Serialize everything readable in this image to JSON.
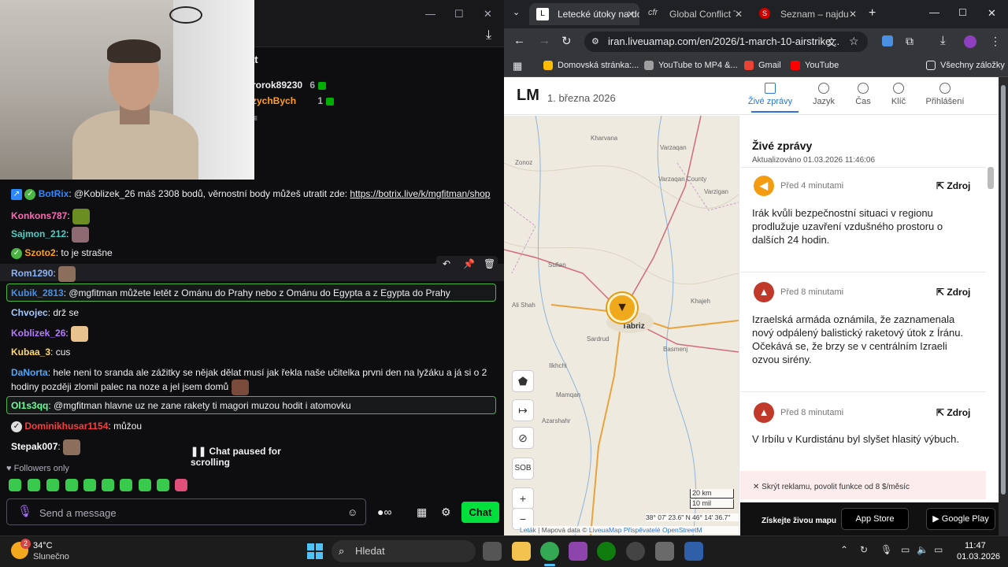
{
  "chat": {
    "title": "at",
    "leaders": [
      {
        "name": "rorok89230",
        "count": "6"
      },
      {
        "name": "zychBych",
        "count": "1"
      }
    ],
    "messages": [
      {
        "user": "BotRix",
        "text": ": @Koblizek_26 máš 2308 bodů, věrnostní body můžeš utratit zde: ",
        "link": "https://botrix.live/k/mgfitman/shop",
        "color": "#2d88ff"
      },
      {
        "user": "Konkons787",
        "text": ":",
        "color": "#ff69b4"
      },
      {
        "user": "Sajmon_212",
        "text": ":",
        "color": "#4ecdc4"
      },
      {
        "user": "Szoto2",
        "text": ": to je strašne",
        "color": "#ff9f1a"
      },
      {
        "user": "Rom1290",
        "text": ":",
        "color": "#8ab4f8"
      },
      {
        "user": "Kubik_2813",
        "text": ": @mgfitman můžete letět z Ománu do Prahy nebo z Ománu do Egypta a z Egypta do Prahy",
        "color": "#4a90e2"
      },
      {
        "user": "Chvojec",
        "text": ": drž se",
        "color": "#a3c9ff"
      },
      {
        "user": "Koblizek_26",
        "text": ":",
        "color": "#b57bff"
      },
      {
        "user": "Kubaa_3",
        "text": ": cus",
        "color": "#ffd966"
      },
      {
        "user": "DaNorta",
        "text": ": hele neni to sranda ale zážitky se nějak dělat musí jak řekla naše učitelka prvni den na lyžáku a já si o 2",
        "text2": "hodiny později zlomil palec na noze a jel jsem domů",
        "color": "#4aa8ff"
      },
      {
        "user": "Ol1s3qq",
        "text": ": @mgfitman hlavne uz ne zane rakety ti magori muzou hodit i atomovku",
        "color": "#66ff99"
      },
      {
        "user": "Dominikhusar1154",
        "text": ": můžou",
        "color": "#ff3b3b"
      },
      {
        "user": "Stepak007",
        "text": ":",
        "color": "#ffffff"
      }
    ],
    "hover_tools": [
      "↶",
      "📌",
      "🗑"
    ],
    "paused_text": "Chat paused for scrolling",
    "followers_only": "Followers only",
    "send_placeholder": "Send a message",
    "chat_button": "Chat"
  },
  "browser": {
    "tabs": [
      {
        "label": "Letecké útoky na dol",
        "active": true
      },
      {
        "label": "Global Conflict Tra",
        "active": false
      },
      {
        "label": "Seznam – najdu tam",
        "active": false
      }
    ],
    "url": "iran.liveuamap.com/en/2026/1-march-10-airstrike...",
    "bookmarks": [
      {
        "label": "Domovská stránka:...",
        "color": "#fbbc04"
      },
      {
        "label": "YouTube to MP4 &...",
        "color": "#9e9e9e"
      },
      {
        "label": "Gmail",
        "color": "#ea4335"
      },
      {
        "label": "YouTube",
        "color": "#ff0000"
      }
    ],
    "all_bookmarks": "Všechny záložky"
  },
  "site": {
    "logo": "LM",
    "date": "1. března 2026",
    "nav": [
      {
        "label": "Živé zprávy",
        "active": true
      },
      {
        "label": "Jazyk",
        "active": false
      },
      {
        "label": "Čas",
        "active": false
      },
      {
        "label": "Klíč",
        "active": false
      },
      {
        "label": "Přihlášení",
        "active": false
      }
    ],
    "feed_title": "Živé zprávy",
    "feed_updated": "Aktualizováno 01.03.2026 11:46:06",
    "cards": [
      {
        "time": "Před 4 minutami",
        "source": "Zdroj",
        "text": "Irák kvůli bezpečnostní situaci v regionu prodlužuje uzavření vzdušného prostoru o dalších 24 hodin.",
        "icon_color": "#f39c12"
      },
      {
        "time": "Před 8 minutami",
        "source": "Zdroj",
        "text": "Izraelská armáda oznámila, že zaznamenala nový odpálený balistický raketový útok z Íránu. Očekává se, že brzy se v centrálním Izraeli ozvou sirény.",
        "icon_color": "#c0392b"
      },
      {
        "time": "Před 8 minutami",
        "source": "Zdroj",
        "text": "V Irbílu v Kurdistánu byl slyšet hlasitý výbuch.",
        "icon_color": "#c0392b"
      }
    ],
    "ad_text": "✕ Skrýt reklamu, povolit funkce od 8 $/měsíc",
    "footer_cta": "Získejte živou mapu",
    "app_store": "App Store",
    "google_play": "Google Play",
    "map": {
      "labels": [
        "Zonoz",
        "Kharvana",
        "Varzaqan",
        "Varzaqan County",
        "Varzigan",
        "Sufian",
        "Ali Shah",
        "Tabriz",
        "Sardrud",
        "Khajeh",
        "Basmenj",
        "Ilkhchi",
        "Azarshahr",
        "Mamqan"
      ],
      "scale_km": "20 km",
      "scale_mi": "10 mil",
      "coords": "38° 07' 23.6\" N 46° 14' 36.7\"",
      "attribution_leaflet": "Leták",
      "attribution_text": "| Mapová data ©",
      "attribution_link": "LiveuaMap",
      "attribution_rest": "Přispěvatelé OpenStreetM",
      "sob_label": "SOB"
    }
  },
  "taskbar": {
    "temp": "34°C",
    "weather": "Slunečno",
    "weather_badge": "2",
    "search": "Hledat",
    "time": "11:47",
    "date": "01.03.2026"
  }
}
